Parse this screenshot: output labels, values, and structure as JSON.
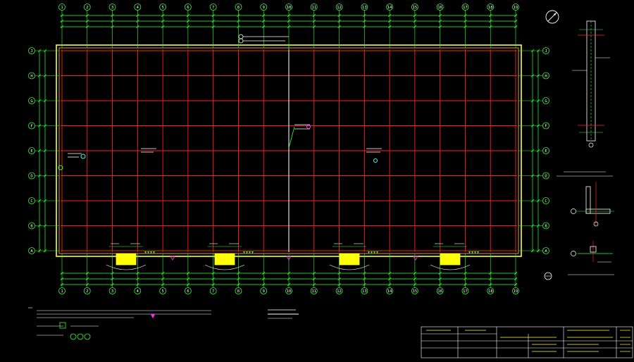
{
  "drawing": {
    "background": "#000000",
    "colors": {
      "grid": "#ff2020",
      "wall": "#ffff33",
      "dim": "#33ff33",
      "text": "#ffffff",
      "accent": "#33ffff",
      "mark": "#ff33ff",
      "door": "#ffff00"
    },
    "col_axes": [
      "1",
      "2",
      "3",
      "4",
      "5",
      "6",
      "7",
      "8",
      "9",
      "10",
      "11",
      "12",
      "13",
      "14",
      "15",
      "16",
      "17",
      "18",
      "19"
    ],
    "row_axes": [
      "A",
      "B",
      "C",
      "D",
      "E",
      "F",
      "G",
      "H",
      "J"
    ],
    "door_count": 4,
    "icons": [
      "north-arrow-icon",
      "section-marker-icon"
    ]
  }
}
